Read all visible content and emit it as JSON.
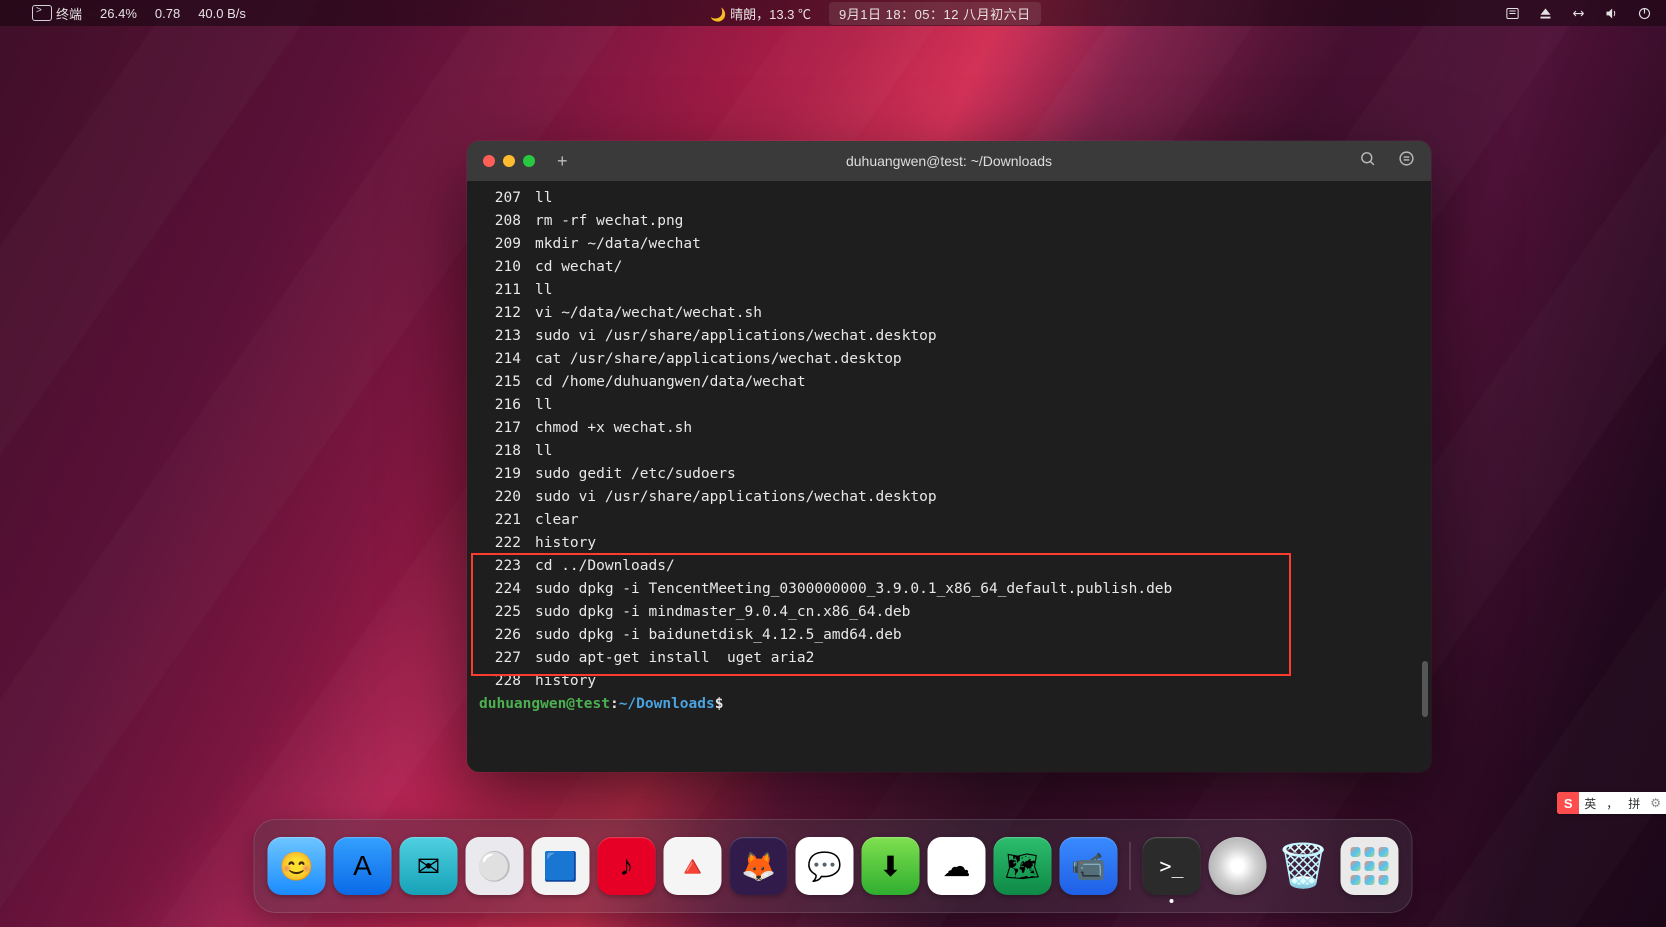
{
  "menubar": {
    "app_name": "终端",
    "cpu": "26.4%",
    "load": "0.78",
    "net": "40.0 B/s",
    "weather": "🌙 晴朗，13.3 ℃",
    "clock": "9月1日 18：05：12 八月初六日"
  },
  "window": {
    "title": "duhuangwen@test: ~/Downloads"
  },
  "history": [
    {
      "n": "207",
      "c": "ll"
    },
    {
      "n": "208",
      "c": "rm -rf wechat.png"
    },
    {
      "n": "209",
      "c": "mkdir ~/data/wechat"
    },
    {
      "n": "210",
      "c": "cd wechat/"
    },
    {
      "n": "211",
      "c": "ll"
    },
    {
      "n": "212",
      "c": "vi ~/data/wechat/wechat.sh"
    },
    {
      "n": "213",
      "c": "sudo vi /usr/share/applications/wechat.desktop"
    },
    {
      "n": "214",
      "c": "cat /usr/share/applications/wechat.desktop"
    },
    {
      "n": "215",
      "c": "cd /home/duhuangwen/data/wechat"
    },
    {
      "n": "216",
      "c": "ll"
    },
    {
      "n": "217",
      "c": "chmod +x wechat.sh"
    },
    {
      "n": "218",
      "c": "ll"
    },
    {
      "n": "219",
      "c": "sudo gedit /etc/sudoers"
    },
    {
      "n": "220",
      "c": "sudo vi /usr/share/applications/wechat.desktop"
    },
    {
      "n": "221",
      "c": "clear"
    },
    {
      "n": "222",
      "c": "history"
    },
    {
      "n": "223",
      "c": "cd ../Downloads/"
    },
    {
      "n": "224",
      "c": "sudo dpkg -i TencentMeeting_0300000000_3.9.0.1_x86_64_default.publish.deb"
    },
    {
      "n": "225",
      "c": "sudo dpkg -i mindmaster_9.0.4_cn.x86_64.deb"
    },
    {
      "n": "226",
      "c": "sudo dpkg -i baidunetdisk_4.12.5_amd64.deb"
    },
    {
      "n": "227",
      "c": "sudo apt-get install  uget aria2"
    },
    {
      "n": "228",
      "c": "history"
    }
  ],
  "highlight": {
    "from": "223",
    "to": "227"
  },
  "prompt": {
    "user": "duhuangwen@test",
    "sep": ":",
    "path": "~/Downloads",
    "end": "$"
  },
  "ime": {
    "logo": "S",
    "lang": "英",
    "punct": "，",
    "mode": "拼"
  },
  "dock": [
    {
      "name": "finder",
      "bg": "linear-gradient(180deg,#6ec5ff,#1a8cff)",
      "glyph": "😊"
    },
    {
      "name": "app-store",
      "bg": "linear-gradient(180deg,#34a0ff,#0a6ae6)",
      "glyph": "A"
    },
    {
      "name": "mail",
      "bg": "linear-gradient(180deg,#4ed0e0,#17a2b8)",
      "glyph": "✉"
    },
    {
      "name": "control-center",
      "bg": "#e9e9ee",
      "glyph": "⚪"
    },
    {
      "name": "edge",
      "bg": "#f3f3f3",
      "glyph": "🟦"
    },
    {
      "name": "netease-music",
      "bg": "#e60026",
      "glyph": "♪"
    },
    {
      "name": "vlc",
      "bg": "#f5f5f5",
      "glyph": "🔺"
    },
    {
      "name": "firefox",
      "bg": "#311b4a",
      "glyph": "🦊"
    },
    {
      "name": "wechat",
      "bg": "#fff",
      "glyph": "💬"
    },
    {
      "name": "downloads",
      "bg": "linear-gradient(180deg,#7fe04f,#2fae2f)",
      "glyph": "⬇"
    },
    {
      "name": "baidu-netdisk",
      "bg": "#fff",
      "glyph": "☁"
    },
    {
      "name": "mindmaster",
      "bg": "linear-gradient(180deg,#2dbd6e,#0e8a46)",
      "glyph": "🗺"
    },
    {
      "name": "tencent-meeting",
      "bg": "linear-gradient(180deg,#3a8bff,#1e5fe6)",
      "glyph": "📹"
    },
    {
      "name": "terminal",
      "bg": "#2b2b2b",
      "glyph": ">_",
      "active": true
    },
    {
      "name": "disc",
      "bg": "radial-gradient(circle,#fff 15%,#d0d0d0 45%,#9a9a9a 100%)",
      "glyph": ""
    },
    {
      "name": "trash",
      "bg": "transparent",
      "glyph": "🗑"
    },
    {
      "name": "launchpad",
      "bg": "#eaeaea",
      "glyph": "▦"
    }
  ]
}
